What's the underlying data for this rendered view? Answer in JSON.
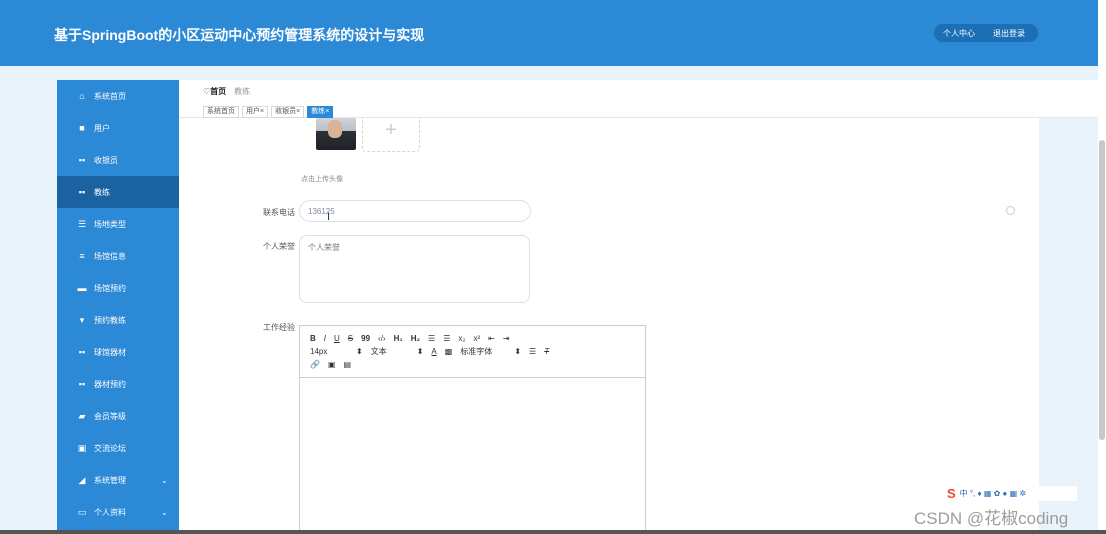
{
  "header": {
    "title": "基于SpringBoot的小区运动中心预约管理系统的设计与实现",
    "actions": [
      "个人中心",
      "退出登录"
    ]
  },
  "sidebar": {
    "items": [
      {
        "label": "系统首页",
        "icon": "home-icon"
      },
      {
        "label": "用户",
        "icon": "user-icon"
      },
      {
        "label": "收银员",
        "icon": "grid-icon"
      },
      {
        "label": "教练",
        "icon": "grid-icon",
        "active": true
      },
      {
        "label": "场地类型",
        "icon": "sliders-icon"
      },
      {
        "label": "场馆信息",
        "icon": "list-icon"
      },
      {
        "label": "场馆预约",
        "icon": "doc-icon"
      },
      {
        "label": "预约教练",
        "icon": "pin-icon"
      },
      {
        "label": "球馆器材",
        "icon": "grid-icon"
      },
      {
        "label": "器材预约",
        "icon": "grid-icon"
      },
      {
        "label": "会员等级",
        "icon": "chat-icon"
      },
      {
        "label": "交流论坛",
        "icon": "clipboard-icon"
      },
      {
        "label": "系统管理",
        "icon": "thumb-icon",
        "chevron": "⌄"
      },
      {
        "label": "个人资料",
        "icon": "window-icon",
        "chevron": "⌄"
      }
    ]
  },
  "breadcrumb": {
    "home": "首页",
    "current": "教练"
  },
  "tabs": [
    {
      "label": "系统首页"
    },
    {
      "label": "用户",
      "close": "×"
    },
    {
      "label": "收银员",
      "close": "×"
    },
    {
      "label": "教练",
      "close": "×",
      "active": true
    }
  ],
  "form": {
    "upload_hint": "点击上传头像",
    "upload_plus": "+",
    "phone_label": "联系电话",
    "phone_value": "136125",
    "honor_label": "个人荣誉",
    "honor_placeholder": "个人荣誉",
    "experience_label": "工作经验"
  },
  "editor": {
    "row1": [
      "B",
      "I",
      "U",
      "S",
      "99",
      "‹/›",
      "H₁",
      "H₂",
      "☰",
      "☰",
      "x₂",
      "x²",
      "⇤",
      "⇥"
    ],
    "font_size": "14px",
    "text_style": "文本",
    "font_family": "标准字体",
    "row3": [
      "🔗",
      "▣",
      "▤"
    ]
  },
  "csdn": {
    "logo": "S",
    "ime": "中 °, ♦ ▦ ✿ ● ▦ ✲",
    "watermark": "CSDN @花椒coding"
  }
}
